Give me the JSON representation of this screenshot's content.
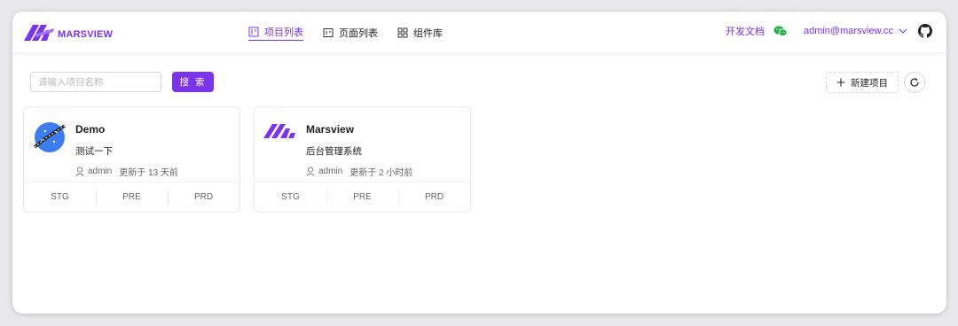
{
  "brand": {
    "name": "MARSVIEW",
    "accent": "#7b33ee"
  },
  "nav": [
    {
      "label": "项目列表",
      "icon": "layout-icon",
      "active": true
    },
    {
      "label": "页面列表",
      "icon": "page-icon",
      "active": false
    },
    {
      "label": "组件库",
      "icon": "grid-icon",
      "active": false
    }
  ],
  "header": {
    "docs_label": "开发文档",
    "user_email": "admin@marsview.cc"
  },
  "toolbar": {
    "search_placeholder": "请输入项目名称",
    "search_button": "搜 索",
    "new_button": "新建项目"
  },
  "projects": [
    {
      "name": "Demo",
      "desc": "测试一下",
      "owner": "admin",
      "updated": "更新于 13 天前",
      "envs": [
        "STG",
        "PRE",
        "PRD"
      ]
    },
    {
      "name": "Marsview",
      "desc": "后台管理系统",
      "owner": "admin",
      "updated": "更新于 2 小时前",
      "envs": [
        "STG",
        "PRE",
        "PRD"
      ]
    }
  ]
}
